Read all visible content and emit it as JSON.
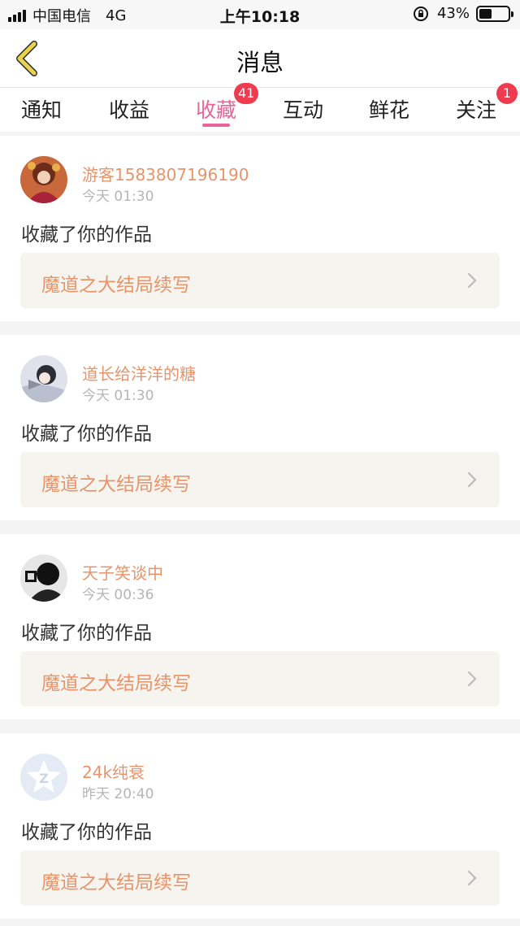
{
  "status_bar": {
    "carrier": "中国电信",
    "network": "4G",
    "time": "上午10:18",
    "battery": "43%",
    "battery_level": 0.43
  },
  "nav": {
    "title": "消息",
    "back_icon": "chevron-left-icon",
    "accent_color": "#e8d34a"
  },
  "tabs": [
    {
      "label": "通知",
      "badge": ""
    },
    {
      "label": "收益",
      "badge": ""
    },
    {
      "label": "收藏",
      "badge": "41",
      "active": true
    },
    {
      "label": "互动",
      "badge": ""
    },
    {
      "label": "鲜花",
      "badge": ""
    },
    {
      "label": "关注",
      "badge": "1"
    }
  ],
  "colors": {
    "active_tab": "#e8649a",
    "username": "#e8946a",
    "badge": "#ef3b4f"
  },
  "messages": [
    {
      "username": "游客1583807196190",
      "time": "今天 01:30",
      "action": "收藏了你的作品",
      "work": "魔道之大结局续写"
    },
    {
      "username": "道长给洋洋的糖",
      "time": "今天 01:30",
      "action": "收藏了你的作品",
      "work": "魔道之大结局续写"
    },
    {
      "username": "天子笑谈中",
      "time": "今天 00:36",
      "action": "收藏了你的作品",
      "work": "魔道之大结局续写"
    },
    {
      "username": "24k纯衰",
      "time": "昨天 20:40",
      "action": "收藏了你的作品",
      "work": "魔道之大结局续写"
    }
  ]
}
